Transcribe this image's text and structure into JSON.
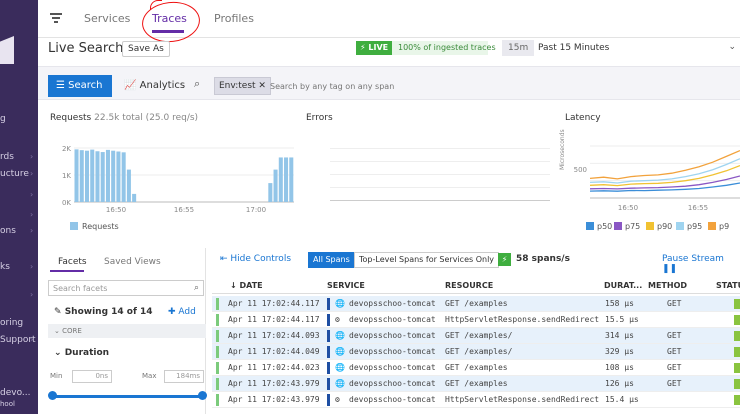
{
  "sidenav": {
    "items": [
      "g",
      "rds",
      "ucture",
      "ons",
      "ks",
      "oring",
      "Support",
      "devo...",
      "hool"
    ]
  },
  "topbar": {
    "tabs": [
      "Services",
      "Traces",
      "Profiles"
    ],
    "active_tab": "Traces"
  },
  "titlebar": {
    "title": "Live Search",
    "save_as": "Save As",
    "live_label": "LIVE",
    "live_text": "100% of ingested traces",
    "time_chip": "15m",
    "time_text": "Past 15 Minutes"
  },
  "searchbar": {
    "search_label": "Search",
    "analytics_label": "Analytics",
    "tag": "Env:test",
    "placeholder": "Search by any tag on any span"
  },
  "charts": {
    "requests_title": "Requests",
    "requests_sub": "22.5k total (25.0 req/s)",
    "errors_title": "Errors",
    "latency_title": "Latency",
    "requests_legend": "Requests",
    "latency_ylabel": "Microseconds",
    "latency_tick": "500",
    "latency_legend": [
      "p50",
      "p75",
      "p90",
      "p95",
      "p9"
    ],
    "colors": {
      "bar": "#92c5e8",
      "p50": "#3b8ed8",
      "p75": "#8a57c4",
      "p90": "#f1c232",
      "p95": "#9fd4f0",
      "p99": "#f2a23c"
    }
  },
  "chart_data": [
    {
      "type": "bar",
      "title": "Requests",
      "x_ticks": [
        "16:50",
        "16:55",
        "17:00"
      ],
      "y_ticks": [
        "0K",
        "1K",
        "2K"
      ],
      "ylim": [
        0,
        2000
      ],
      "values": [
        1950,
        1920,
        1900,
        1940,
        1880,
        1850,
        1930,
        1900,
        1870,
        1840,
        1200,
        300,
        0,
        0,
        0,
        0,
        0,
        0,
        0,
        0,
        0,
        0,
        0,
        0,
        0,
        0,
        0,
        0,
        0,
        0,
        0,
        0,
        0,
        0,
        0,
        0,
        0,
        700,
        1200,
        1650,
        1650,
        1650
      ]
    },
    {
      "type": "line",
      "title": "Latency",
      "x_ticks": [
        "16:50",
        "16:55"
      ],
      "series": [
        {
          "name": "p50",
          "values": [
            120,
            125,
            118,
            130,
            128,
            135,
            140,
            150,
            165,
            190,
            220,
            260
          ]
        },
        {
          "name": "p75",
          "values": [
            160,
            165,
            158,
            170,
            175,
            180,
            190,
            205,
            230,
            270,
            320,
            380
          ]
        },
        {
          "name": "p90",
          "values": [
            220,
            230,
            215,
            240,
            250,
            255,
            270,
            300,
            340,
            400,
            470,
            560
          ]
        },
        {
          "name": "p95",
          "values": [
            270,
            280,
            260,
            290,
            300,
            310,
            330,
            370,
            420,
            490,
            580,
            680
          ]
        },
        {
          "name": "p9",
          "values": [
            340,
            360,
            330,
            370,
            390,
            400,
            430,
            480,
            540,
            620,
            720,
            820
          ]
        }
      ]
    }
  ],
  "facets": {
    "tab_facets": "Facets",
    "tab_saved": "Saved Views",
    "search_placeholder": "Search facets",
    "showing": "Showing 14 of 14",
    "add": "Add",
    "core": "CORE",
    "duration": "Duration",
    "min_label": "Min",
    "min_value": "0ns",
    "max_label": "Max",
    "max_value": "184ms"
  },
  "spans": {
    "hide_controls": "Hide Controls",
    "all_spans": "All Spans",
    "top_level": "Top-Level Spans for Services Only",
    "rate": "58 spans/s",
    "pause": "Pause Stream",
    "columns": [
      "DATE",
      "SERVICE",
      "RESOURCE",
      "DURAT...",
      "METHOD",
      "STATU"
    ],
    "rows": [
      {
        "date": "Apr 11 17:02:44.117",
        "service": "devopsschoo-tomcat",
        "resource": "GET /examples",
        "duration": "158 µs",
        "method": "GET",
        "icon": "globe",
        "hl": true
      },
      {
        "date": "Apr 11 17:02:44.117",
        "service": "devopsschoo-tomcat",
        "resource": "HttpServletResponse.sendRedirect",
        "duration": "15.5 µs",
        "method": "",
        "icon": "gear",
        "hl": false
      },
      {
        "date": "Apr 11 17:02:44.093",
        "service": "devopsschoo-tomcat",
        "resource": "GET /examples/",
        "duration": "314 µs",
        "method": "GET",
        "icon": "globe",
        "hl": true
      },
      {
        "date": "Apr 11 17:02:44.049",
        "service": "devopsschoo-tomcat",
        "resource": "GET /examples/",
        "duration": "329 µs",
        "method": "GET",
        "icon": "globe",
        "hl": true
      },
      {
        "date": "Apr 11 17:02:44.023",
        "service": "devopsschoo-tomcat",
        "resource": "GET /examples",
        "duration": "108 µs",
        "method": "GET",
        "icon": "globe",
        "hl": false
      },
      {
        "date": "Apr 11 17:02:43.979",
        "service": "devopsschoo-tomcat",
        "resource": "GET /examples",
        "duration": "126 µs",
        "method": "GET",
        "icon": "globe",
        "hl": true
      },
      {
        "date": "Apr 11 17:02:43.979",
        "service": "devopsschoo-tomcat",
        "resource": "HttpServletResponse.sendRedirect",
        "duration": "15.4 µs",
        "method": "",
        "icon": "gear",
        "hl": false
      }
    ]
  }
}
